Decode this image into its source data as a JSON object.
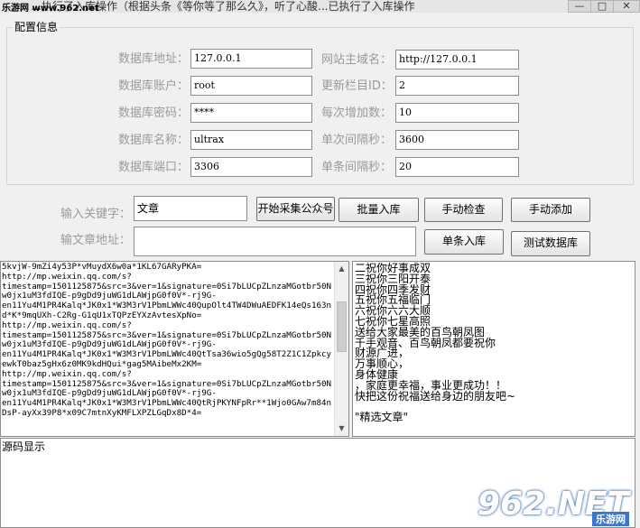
{
  "window": {
    "title": "…执行了入库操作（根据头条《等你等了那么久》，听了心酸...已执行了入库操作",
    "site_logo": "乐游网 www.962.net",
    "controls": {
      "minimize": "—",
      "maximize": "□",
      "close": "✕"
    }
  },
  "config": {
    "group_title": "配置信息",
    "fields": {
      "db_address": {
        "label": "数据库地址：",
        "value": "127.0.0.1"
      },
      "db_user": {
        "label": "数据库账户：",
        "value": "root"
      },
      "db_password": {
        "label": "数据库密码：",
        "value": "****"
      },
      "db_name": {
        "label": "数据库名称：",
        "value": "ultrax"
      },
      "db_port": {
        "label": "数据库端口：",
        "value": "3306"
      },
      "site_domain": {
        "label": "网站主域名：",
        "value": "http://127.0.0.1"
      },
      "column_id": {
        "label": "更新栏目ID：",
        "value": "2"
      },
      "increment": {
        "label": "每次增加数：",
        "value": "10"
      },
      "interval": {
        "label": "单次间隔秒：",
        "value": "3600"
      },
      "item_interval": {
        "label": "单条间隔秒：",
        "value": "20"
      }
    }
  },
  "actions": {
    "keyword_label": "输入关键字：",
    "keyword_value": "文章",
    "article_url_label": "输文章地址：",
    "article_url_value": "",
    "start_collect": "开始采集公众号",
    "batch_import": "批量入库",
    "manual_check": "手动检查",
    "manual_add": "手动添加",
    "single_import": "单条入库",
    "test_db": "测试数据库"
  },
  "log": {
    "lines": [
      "5kvjW-9mZi4y53P*vMuydX6w0a*1KL67GARyPKA=",
      "http://mp.weixin.qq.com/s?",
      "timestamp=1501125875&src=3&ver=1&signature=0Si7bLUCpZLnzaMGotbr50N",
      "w0jx1uM3fdIQE-p9gDd9juWG1dLAWjpG0f0V*-rj9G-",
      "en11Yu4M1PR4Kalq*JK0x1*W3M3rV1PbmLWWc40QupOlt4TW4DWuAEDFK14eQs163n",
      "d*K*9mqUXh-C2Rg-G1qU1xTQPzEYXzAvtesXpNo=",
      "http://mp.weixin.qq.com/s?",
      "timestamp=1501125875&src=3&ver=1&signature=0Si7bLUCpZLnzaMGotbr50N",
      "w0jx1uM3fdIQE-p9gDd9juWG1dLAWjpG0f0V*-rj9G-",
      "en11Yu4M1PR4Kalq*JK0x1*W3M3rV1PbmLWWc40QtTsa36wio5gQg58T2Z1C1Zpkcy",
      "ewkT0baz5gHx6z0MK9kdHQui*gag5MAibeMx2KM=",
      "http://mp.weixin.qq.com/s?",
      "timestamp=1501125875&src=3&ver=1&signature=0Si7bLUCpZLnzaMGotbr50N",
      "w0jx1uM3fdIQE-p9gDd9juWG1dLAWjpG0f0V*-rj9G-",
      "en11Yu4M1PR4Kalq*JK0x1*W3M3rV1PbmLWWc40QtRjPKYNFpRr**1Wjo0GAw7m84n",
      "DsP-ayXx39P8*x09C7mtnXyKMFLXPZLGqDx8D*4="
    ]
  },
  "blessings": {
    "lines": [
      "二祝你好事成双",
      "三祝你三阳开泰",
      "四祝你四季发财",
      "五祝你五福临门",
      "六祝你六六大顺",
      "七祝你七星高照",
      "送给大家最美的百鸟朝凤图",
      "千手观音、百鸟朝凤都要祝你",
      "财源广进，",
      "万事顺心，",
      "身体健康",
      "，家庭更幸福，事业更成功！！",
      "快把这份祝福送给身边的朋友吧~",
      "",
      "\"精选文章\""
    ]
  },
  "source": {
    "label": "源码显示"
  },
  "watermark": {
    "brand": "962.NET",
    "sub": "乐游网"
  }
}
